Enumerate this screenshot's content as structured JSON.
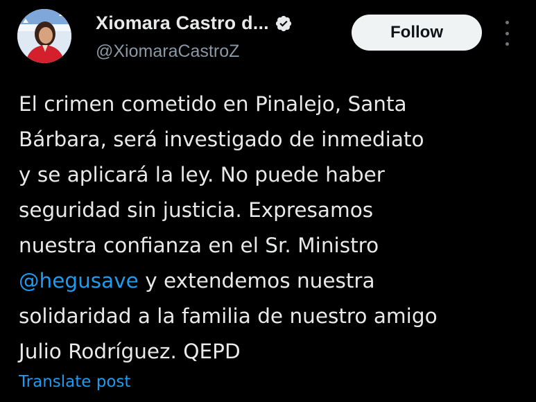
{
  "post": {
    "author": {
      "display_name": "Xiomara Castro d...",
      "handle": "@XiomaraCastroZ",
      "verified": true
    },
    "follow_label": "Follow",
    "text_before_mention": "El crimen cometido en Pinalejo, Santa\nBárbara, será investigado de inmediato\ny se aplicará la ley. No puede haber\nseguridad sin justicia. Expresamos\nnuestra confianza en el Sr. Ministro\n",
    "mention": "@hegusave",
    "text_after_mention": " y extendemos nuestra\nsolidaridad a la familia de nuestro amigo\nJulio Rodríguez. QEPD",
    "translate_label": "Translate post"
  },
  "icons": {
    "avatar": "avatar-photo",
    "verified": "verified-badge-icon",
    "more": "more-options-icon"
  },
  "colors": {
    "background": "#000000",
    "text": "#e7e9ea",
    "secondary_text": "#8b98a5",
    "link": "#1d9bf0",
    "follow_button": "#eff3f4"
  }
}
